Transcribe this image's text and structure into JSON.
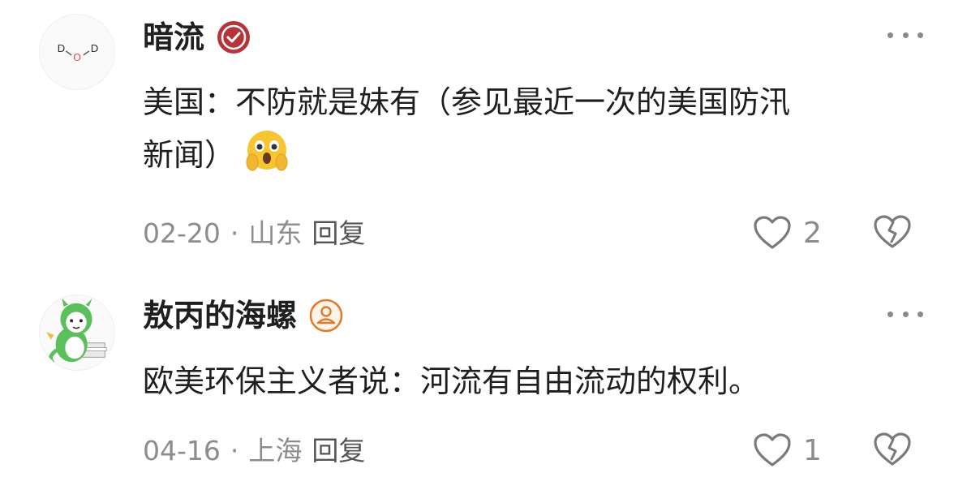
{
  "comments": [
    {
      "username": "暗流",
      "badge": "verified-badge-icon",
      "avatar_text": [
        "D",
        "O",
        "D"
      ],
      "content_line1": "美国：不防就是妹有（参见最近一次的美国防汛",
      "content_line2": "新闻）",
      "date": "02-20",
      "separator": "·",
      "location": "山东",
      "reply_label": "回复",
      "like_count": "2"
    },
    {
      "username": "敖丙的海螺",
      "badge": "user-badge-icon",
      "content_line1": "欧美环保主义者说：河流有自由流动的权利。",
      "date": "04-16",
      "separator": "·",
      "location": "上海",
      "reply_label": "回复",
      "like_count": "1"
    }
  ],
  "colors": {
    "verified_badge": "#b4343a",
    "user_badge": "#e07b2e",
    "meta_text": "#8c8c8c",
    "avatar_dragon": "#4caf50"
  }
}
